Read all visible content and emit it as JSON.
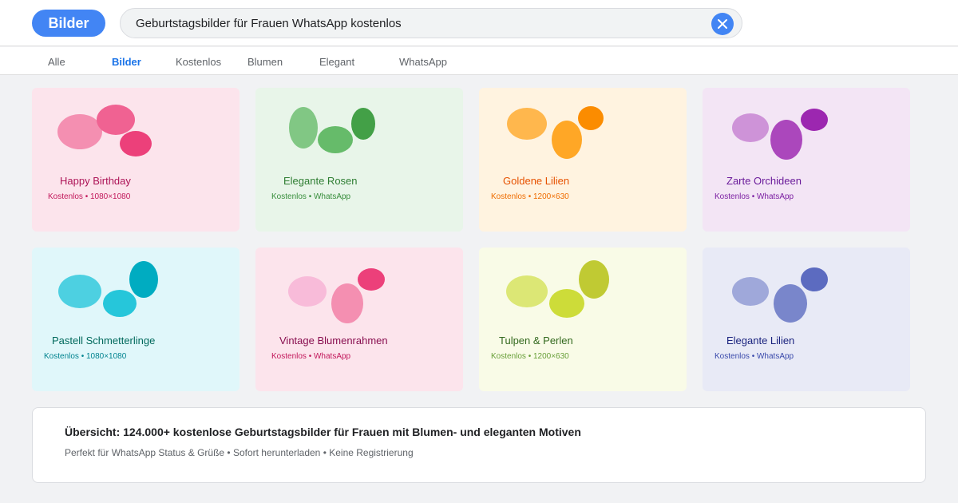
{
  "header": {
    "logo_label": "Bilder",
    "search_value": "Geburtstagsbilder für Frauen WhatsApp kostenlos",
    "accent_color": "#4285f4"
  },
  "tabs": [
    {
      "label": "Alle",
      "active": false
    },
    {
      "label": "Bilder",
      "active": true
    },
    {
      "label": "Kostenlos",
      "active": false
    },
    {
      "label": "Blumen",
      "active": false
    },
    {
      "label": "Elegant",
      "active": false
    },
    {
      "label": "WhatsApp",
      "active": false
    }
  ],
  "cards": [
    {
      "title": "Happy Birthday",
      "meta": "Kostenlos • 1080×1080",
      "bg": "#fce4ec",
      "title_color": "#ad1457",
      "meta_color": "#c2185b",
      "blob_colors": [
        "#f48fb1",
        "#f06292",
        "#ec407a"
      ]
    },
    {
      "title": "Elegante Rosen",
      "meta": "Kostenlos • WhatsApp",
      "bg": "#e8f5e9",
      "title_color": "#2e7d32",
      "meta_color": "#388e3c",
      "blob_colors": [
        "#81c784",
        "#66bb6a",
        "#43a047"
      ]
    },
    {
      "title": "Goldene Lilien",
      "meta": "Kostenlos • 1200×630",
      "bg": "#fff3e0",
      "title_color": "#e65100",
      "meta_color": "#ef6c00",
      "blob_colors": [
        "#ffb74d",
        "#ffa726",
        "#fb8c00"
      ]
    },
    {
      "title": "Zarte Orchideen",
      "meta": "Kostenlos • WhatsApp",
      "bg": "#f3e5f5",
      "title_color": "#6a1b9a",
      "meta_color": "#7b1fa2",
      "blob_colors": [
        "#ce93d8",
        "#ab47bc",
        "#9c27b0"
      ]
    },
    {
      "title": "Pastell Schmetterlinge",
      "meta": "Kostenlos • 1080×1080",
      "bg": "#e0f7fa",
      "title_color": "#00695c",
      "meta_color": "#00838f",
      "blob_colors": [
        "#4dd0e1",
        "#26c6da",
        "#00acc1"
      ]
    },
    {
      "title": "Vintage Blumenrahmen",
      "meta": "Kostenlos • WhatsApp",
      "bg": "#fce4ec",
      "title_color": "#880e4f",
      "meta_color": "#c2185b",
      "blob_colors": [
        "#f8bbd9",
        "#f48fb1",
        "#ec407a"
      ]
    },
    {
      "title": "Tulpen & Perlen",
      "meta": "Kostenlos • 1200×630",
      "bg": "#f9fbe7",
      "title_color": "#33691e",
      "meta_color": "#689f38",
      "blob_colors": [
        "#dce775",
        "#cddc39",
        "#c0ca33"
      ]
    },
    {
      "title": "Elegante Lilien",
      "meta": "Kostenlos • WhatsApp",
      "bg": "#e8eaf6",
      "title_color": "#1a237e",
      "meta_color": "#3949ab",
      "blob_colors": [
        "#9fa8da",
        "#7986cb",
        "#5c6bc0"
      ]
    }
  ],
  "summary": {
    "title": "Übersicht: 124.000+ kostenlose Geburtstagsbilder für Frauen mit Blumen- und eleganten Motiven",
    "subtitle": "Perfekt für WhatsApp Status & Grüße • Sofort herunterladen • Keine Registrierung"
  }
}
